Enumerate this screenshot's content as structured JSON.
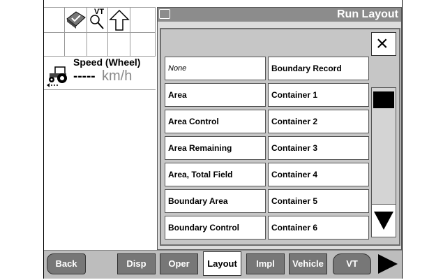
{
  "window": {
    "title": "Run Layout"
  },
  "speed": {
    "label": "Speed (Wheel)",
    "value": "-----",
    "unit": "km/h"
  },
  "left_panel": {
    "vt_label": "VT"
  },
  "popup": {
    "close_glyph": "×",
    "options_left": [
      "None",
      "Area",
      "Area Control",
      "Area Remaining",
      "Area, Total Field",
      "Boundary Area",
      "Boundary Control"
    ],
    "options_right": [
      "Boundary Record",
      "Container 1",
      "Container 2",
      "Container 3",
      "Container 4",
      "Container 5",
      "Container 6"
    ]
  },
  "tabs": [
    {
      "label": "Back"
    },
    {
      "label": "Disp"
    },
    {
      "label": "Oper"
    },
    {
      "label": "Layout"
    },
    {
      "label": "Impl"
    },
    {
      "label": "Vehicle"
    },
    {
      "label": "VT"
    }
  ],
  "colors": {
    "title_bar": "#8c8c8c",
    "tab_inactive": "#777777",
    "tab_active": "#ffffff"
  }
}
